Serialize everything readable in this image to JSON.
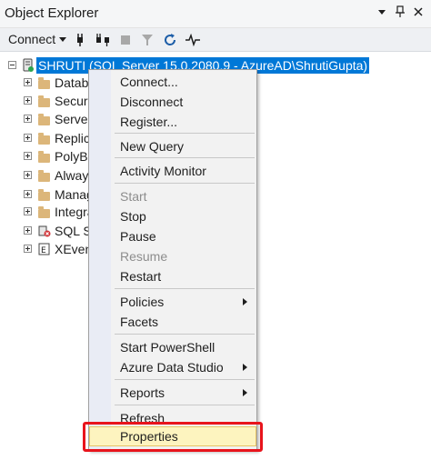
{
  "window": {
    "title": "Object Explorer",
    "controls": [
      "dropdown-icon",
      "pin-icon",
      "close-icon"
    ]
  },
  "toolbar": {
    "connect_label": "Connect",
    "tools": [
      "connect-plug-icon",
      "disconnect-plug-icon",
      "stop-icon",
      "filter-icon",
      "refresh-icon",
      "activity-icon"
    ]
  },
  "tree": {
    "server": "SHRUTI (SQL Server 15.0.2080.9 - AzureAD\\ShrutiGupta)",
    "children": [
      {
        "label": "Datab",
        "icon": "folder-icon"
      },
      {
        "label": "Securi",
        "icon": "folder-icon"
      },
      {
        "label": "Server",
        "icon": "folder-icon"
      },
      {
        "label": "Replic",
        "icon": "folder-icon"
      },
      {
        "label": "PolyBa",
        "icon": "folder-icon"
      },
      {
        "label": "Alway",
        "icon": "folder-icon"
      },
      {
        "label": "Manag",
        "icon": "folder-icon"
      },
      {
        "label": "Integra",
        "icon": "folder-icon"
      },
      {
        "label": "SQL Se",
        "icon": "sql-agent-icon"
      },
      {
        "label": "XEven",
        "icon": "xevent-icon"
      }
    ]
  },
  "context_menu": {
    "items": [
      {
        "label": "Connect...",
        "enabled": true
      },
      {
        "label": "Disconnect",
        "enabled": true
      },
      {
        "label": "Register...",
        "enabled": true
      },
      {
        "label": "New Query",
        "enabled": true
      },
      {
        "label": "Activity Monitor",
        "enabled": true
      },
      {
        "label": "Start",
        "enabled": false
      },
      {
        "label": "Stop",
        "enabled": true
      },
      {
        "label": "Pause",
        "enabled": true
      },
      {
        "label": "Resume",
        "enabled": false
      },
      {
        "label": "Restart",
        "enabled": true
      },
      {
        "label": "Policies",
        "enabled": true,
        "submenu": true
      },
      {
        "label": "Facets",
        "enabled": true
      },
      {
        "label": "Start PowerShell",
        "enabled": true
      },
      {
        "label": "Azure Data Studio",
        "enabled": true,
        "submenu": true
      },
      {
        "label": "Reports",
        "enabled": true,
        "submenu": true
      },
      {
        "label": "Refresh",
        "enabled": true
      },
      {
        "label": "Properties",
        "enabled": true,
        "hovered": true
      }
    ]
  },
  "colors": {
    "selection": "#0078d7",
    "hover": "#fdf4bf",
    "annotation": "#e8141c",
    "folder": "#dcb67a"
  }
}
